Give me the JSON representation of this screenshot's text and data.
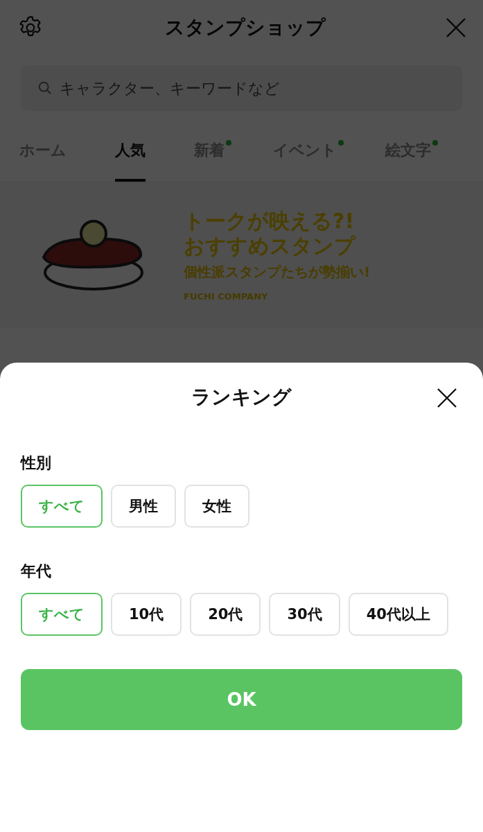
{
  "header": {
    "title": "スタンプショップ"
  },
  "search": {
    "placeholder": "キャラクター、キーワードなど"
  },
  "tabs": [
    {
      "label": "ホーム",
      "selected": false,
      "new": false
    },
    {
      "label": "人気",
      "selected": true,
      "new": false
    },
    {
      "label": "新着",
      "selected": false,
      "new": true
    },
    {
      "label": "イベント",
      "selected": false,
      "new": true
    },
    {
      "label": "絵文字",
      "selected": false,
      "new": true
    }
  ],
  "banner": {
    "headline": [
      "トークが映える?!",
      "おすすめスタンプ"
    ],
    "subtitle": "個性派スタンプたちが勢揃い!",
    "credit": "FUCHI COMPANY"
  },
  "sheet": {
    "title": "ランキング",
    "sections": [
      {
        "label": "性別",
        "options": [
          {
            "label": "すべて",
            "selected": true
          },
          {
            "label": "男性",
            "selected": false
          },
          {
            "label": "女性",
            "selected": false
          }
        ]
      },
      {
        "label": "年代",
        "options": [
          {
            "label": "すべて",
            "selected": true
          },
          {
            "label": "10代",
            "selected": false
          },
          {
            "label": "20代",
            "selected": false
          },
          {
            "label": "30代",
            "selected": false
          },
          {
            "label": "40代以上",
            "selected": false
          }
        ]
      }
    ],
    "button": "OK"
  }
}
